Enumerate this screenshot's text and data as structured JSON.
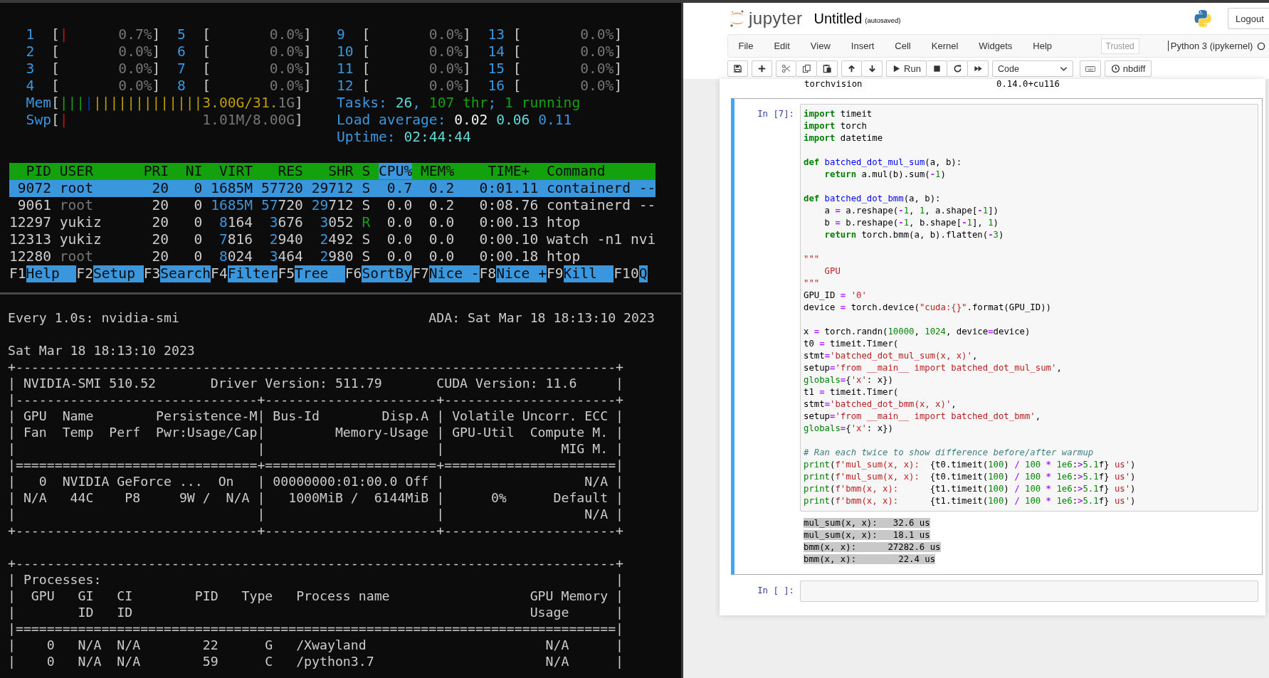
{
  "htop": {
    "meters": [
      {
        "runs": [
          {
            "text": "  1",
            "color": "#3a96dd"
          },
          "  [",
          {
            "text": "|",
            "color": "#c50f1f"
          },
          {
            "text": "      0.7%",
            "color": "#767676"
          },
          "]  ",
          {
            "text": "5",
            "color": "#3a96dd"
          },
          "  [",
          {
            "text": "       0.0%",
            "color": "#767676"
          },
          "]   ",
          {
            "text": "9",
            "color": "#3a96dd"
          },
          "  [",
          {
            "text": "       0.0%",
            "color": "#767676"
          },
          "]  ",
          {
            "text": "13",
            "color": "#3a96dd"
          },
          " [",
          {
            "text": "       0.0%",
            "color": "#767676"
          },
          "]"
        ]
      },
      {
        "runs": [
          {
            "text": "  2",
            "color": "#3a96dd"
          },
          "  [",
          {
            "text": "       0.0%",
            "color": "#767676"
          },
          "]  ",
          {
            "text": "6",
            "color": "#3a96dd"
          },
          "  [",
          {
            "text": "       0.0%",
            "color": "#767676"
          },
          "]   ",
          {
            "text": "10",
            "color": "#3a96dd"
          },
          " [",
          {
            "text": "       0.0%",
            "color": "#767676"
          },
          "]  ",
          {
            "text": "14",
            "color": "#3a96dd"
          },
          " [",
          {
            "text": "       0.0%",
            "color": "#767676"
          },
          "]"
        ]
      },
      {
        "runs": [
          {
            "text": "  3",
            "color": "#3a96dd"
          },
          "  [",
          {
            "text": "       0.0%",
            "color": "#767676"
          },
          "]  ",
          {
            "text": "7",
            "color": "#3a96dd"
          },
          "  [",
          {
            "text": "       0.0%",
            "color": "#767676"
          },
          "]   ",
          {
            "text": "11",
            "color": "#3a96dd"
          },
          " [",
          {
            "text": "       0.0%",
            "color": "#767676"
          },
          "]  ",
          {
            "text": "15",
            "color": "#3a96dd"
          },
          " [",
          {
            "text": "       0.0%",
            "color": "#767676"
          },
          "]"
        ]
      },
      {
        "runs": [
          {
            "text": "  4",
            "color": "#3a96dd"
          },
          "  [",
          {
            "text": "       0.0%",
            "color": "#767676"
          },
          "]  ",
          {
            "text": "8",
            "color": "#3a96dd"
          },
          "  [",
          {
            "text": "       0.0%",
            "color": "#767676"
          },
          "]   ",
          {
            "text": "12",
            "color": "#3a96dd"
          },
          " [",
          {
            "text": "       0.0%",
            "color": "#767676"
          },
          "]  ",
          {
            "text": "16",
            "color": "#3a96dd"
          },
          " [",
          {
            "text": "       0.0%",
            "color": "#767676"
          },
          "]"
        ]
      },
      {
        "runs": [
          {
            "text": "  Mem",
            "color": "#3a96dd"
          },
          "[",
          {
            "text": "|||",
            "color": "#13a10e"
          },
          {
            "text": "|",
            "color": "#0037da"
          },
          {
            "text": "|||||||||||||3.00G/31.",
            "color": "#c19c00"
          },
          {
            "text": "1G",
            "color": "#767676"
          },
          "]    ",
          {
            "text": "Tasks: ",
            "color": "#3a96dd"
          },
          {
            "text": "26",
            "color": "#61d6d6"
          },
          {
            "text": ", ",
            "color": "#3a96dd"
          },
          {
            "text": "107 thr",
            "color": "#13a10e"
          },
          {
            "text": "; ",
            "color": "#3a96dd"
          },
          {
            "text": "1 running",
            "color": "#13a10e"
          }
        ]
      },
      {
        "runs": [
          {
            "text": "  Swp",
            "color": "#3a96dd"
          },
          "[",
          {
            "text": "|",
            "color": "#c50f1f"
          },
          {
            "text": "                1.01M/8.00G",
            "color": "#767676"
          },
          "]    ",
          {
            "text": "Load average: ",
            "color": "#3a96dd"
          },
          {
            "text": "0.02 ",
            "color": "#f2f2f2"
          },
          {
            "text": "0.06 ",
            "color": "#61d6d6"
          },
          {
            "text": "0.11",
            "color": "#3a96dd"
          }
        ]
      },
      {
        "runs": [
          {
            "text": "                                       Uptime: ",
            "color": "#3a96dd"
          },
          {
            "text": "02:44:44",
            "color": "#61d6d6"
          }
        ]
      }
    ],
    "process_header": {
      "runs": [
        "  PID USER      PRI  NI  VIRT   RES   SHR S ",
        {
          "text": "CPU%",
          "selected": true
        },
        " MEM%    TIME+  Command"
      ]
    },
    "processes": [
      {
        "selected": true,
        "runs": [
          " 9072 root       20   0 1685M 57720 29712 S  0.7  0.2   0:01.11 containerd --"
        ]
      },
      {
        "selected": false,
        "runs": [
          " 9061 ",
          {
            "text": "root",
            "color": "#767676"
          },
          "       20   0 ",
          {
            "text": "1685M ",
            "color": "#3a96dd"
          },
          {
            "text": "57",
            "color": "#3a96dd"
          },
          "720 ",
          {
            "text": "29",
            "color": "#3a96dd"
          },
          "712 S  0.0  0.2   0:08.76 containerd --"
        ]
      },
      {
        "selected": false,
        "runs": [
          "12297 yukiz      20   0  ",
          {
            "text": "8",
            "color": "#3a96dd"
          },
          "164  ",
          {
            "text": "3",
            "color": "#3a96dd"
          },
          "676  ",
          {
            "text": "3",
            "color": "#3a96dd"
          },
          "052 ",
          {
            "text": "R",
            "color": "#13a10e"
          },
          "  0.0  0.0   0:00.13 htop"
        ]
      },
      {
        "selected": false,
        "runs": [
          "12313 yukiz      20   0  ",
          {
            "text": "7",
            "color": "#3a96dd"
          },
          "816  ",
          {
            "text": "2",
            "color": "#3a96dd"
          },
          "940  ",
          {
            "text": "2",
            "color": "#3a96dd"
          },
          "492 S  0.0  0.0   0:00.10 watch -n1 nvi"
        ]
      },
      {
        "selected": false,
        "runs": [
          "12280 ",
          {
            "text": "root",
            "color": "#767676"
          },
          "       20   0  ",
          {
            "text": "8",
            "color": "#3a96dd"
          },
          "024  ",
          {
            "text": "3",
            "color": "#3a96dd"
          },
          "464  ",
          {
            "text": "2",
            "color": "#3a96dd"
          },
          "980 S  0.0  0.0   0:00.18 htop"
        ]
      }
    ],
    "function_keys": [
      {
        "key": "F1",
        "label": "Help"
      },
      {
        "key": "F2",
        "label": "Setup"
      },
      {
        "key": "F3",
        "label": "Search"
      },
      {
        "key": "F4",
        "label": "Filter"
      },
      {
        "key": "F5",
        "label": "Tree"
      },
      {
        "key": "F6",
        "label": "SortBy"
      },
      {
        "key": "F7",
        "label": "Nice -"
      },
      {
        "key": "F8",
        "label": "Nice +"
      },
      {
        "key": "F9",
        "label": "Kill"
      },
      {
        "key": "F10",
        "label": "Q"
      }
    ]
  },
  "nvidia_smi": {
    "command": "Every 1.0s: nvidia-smi",
    "host_time": "ADA: Sat Mar 18 18:13:10 2023",
    "timestamp": "Sat Mar 18 18:13:10 2023",
    "gpu_table": [
      "+-----------------------------------------------------------------------------+",
      "| NVIDIA-SMI 510.52       Driver Version: 511.79       CUDA Version: 11.6     |",
      "|-------------------------------+----------------------+----------------------+",
      "| GPU  Name        Persistence-M| Bus-Id        Disp.A | Volatile Uncorr. ECC |",
      "| Fan  Temp  Perf  Pwr:Usage/Cap|         Memory-Usage | GPU-Util  Compute M. |",
      "|                               |                      |               MIG M. |",
      "|===============================+======================+======================|",
      "|   0  NVIDIA GeForce ...  On   | 00000000:01:00.0 Off |                  N/A |",
      "| N/A   44C    P8     9W /  N/A |   1000MiB /  6144MiB |      0%      Default |",
      "|                               |                      |                  N/A |",
      "+-------------------------------+----------------------+----------------------+"
    ],
    "process_table": [
      "+-----------------------------------------------------------------------------+",
      "| Processes:                                                                  |",
      "|  GPU   GI   CI        PID   Type   Process name                  GPU Memory |",
      "|        ID   ID                                                   Usage      |",
      "|=============================================================================|",
      "|    0   N/A  N/A        22      G   /Xwayland                       N/A      |",
      "|    0   N/A  N/A        59      C   /python3.7                      N/A      |"
    ]
  },
  "jupyter": {
    "logo_text": "jupyter",
    "title": "Untitled",
    "save_status": "(autosaved)",
    "logout": "Logout",
    "menu": [
      "File",
      "Edit",
      "View",
      "Insert",
      "Cell",
      "Kernel",
      "Widgets",
      "Help"
    ],
    "trusted": "Trusted",
    "kernel": "Python 3 (ipykernel)",
    "toolbar": {
      "run": "Run",
      "cell_type": "Code",
      "nbdiff": "nbdiff"
    },
    "previous_output": {
      "package": "torchvision",
      "version": "0.14.0+cu116"
    },
    "cells": [
      {
        "prompt": "In [7]:",
        "selected": true,
        "code_blocks": [
          {
            "lines": [
              {
                "runs": [
                  {
                    "text": "import",
                    "kind": "keyword"
                  },
                  " timeit"
                ]
              },
              {
                "runs": [
                  {
                    "text": "import",
                    "kind": "keyword"
                  },
                  " torch"
                ]
              },
              {
                "runs": [
                  {
                    "text": "import",
                    "kind": "keyword"
                  },
                  " datetime"
                ]
              }
            ]
          },
          {
            "lines": [
              {
                "runs": [
                  {
                    "text": "def",
                    "kind": "keyword"
                  },
                  {
                    "text": " batched_dot_mul_sum",
                    "kind": "function"
                  },
                  "(a, b):"
                ]
              },
              {
                "runs": [
                  {
                    "text": "    return",
                    "kind": "keyword"
                  },
                  " a.mul(b).sum(",
                  {
                    "text": "-",
                    "kind": "operator"
                  },
                  {
                    "text": "1",
                    "kind": "number"
                  },
                  ")"
                ]
              }
            ]
          },
          {
            "lines": [
              {
                "runs": [
                  {
                    "text": "def",
                    "kind": "keyword"
                  },
                  {
                    "text": " batched_dot_bmm",
                    "kind": "function"
                  },
                  "(a, b):"
                ]
              },
              {
                "runs": [
                  "    a ",
                  {
                    "text": "=",
                    "kind": "operator"
                  },
                  " a.reshape(",
                  {
                    "text": "-",
                    "kind": "operator"
                  },
                  {
                    "text": "1",
                    "kind": "number"
                  },
                  ", ",
                  {
                    "text": "1",
                    "kind": "number"
                  },
                  ", a.shape[",
                  {
                    "text": "-",
                    "kind": "operator"
                  },
                  {
                    "text": "1",
                    "kind": "number"
                  },
                  "])"
                ]
              },
              {
                "runs": [
                  "    b ",
                  {
                    "text": "=",
                    "kind": "operator"
                  },
                  " b.reshape(",
                  {
                    "text": "-",
                    "kind": "operator"
                  },
                  {
                    "text": "1",
                    "kind": "number"
                  },
                  ", b.shape[",
                  {
                    "text": "-",
                    "kind": "operator"
                  },
                  {
                    "text": "1",
                    "kind": "number"
                  },
                  "], ",
                  {
                    "text": "1",
                    "kind": "number"
                  },
                  ")"
                ]
              },
              {
                "runs": [
                  {
                    "text": "    return",
                    "kind": "keyword"
                  },
                  " torch.bmm(a, b).flatten(",
                  {
                    "text": "-",
                    "kind": "operator"
                  },
                  {
                    "text": "3",
                    "kind": "number"
                  },
                  ")"
                ]
              }
            ]
          },
          {
            "lines": [
              {
                "runs": [
                  {
                    "text": "\"\"\"",
                    "kind": "string"
                  }
                ]
              },
              {
                "runs": [
                  {
                    "text": "    GPU",
                    "kind": "string"
                  }
                ]
              },
              {
                "runs": [
                  {
                    "text": "\"\"\"",
                    "kind": "string"
                  }
                ]
              },
              {
                "runs": [
                  "GPU_ID ",
                  {
                    "text": "=",
                    "kind": "operator"
                  },
                  {
                    "text": " '0'",
                    "kind": "string"
                  }
                ]
              },
              {
                "runs": [
                  "device ",
                  {
                    "text": "=",
                    "kind": "operator"
                  },
                  " torch.device(",
                  {
                    "text": "\"cuda:{}\"",
                    "kind": "string"
                  },
                  ".format(GPU_ID))"
                ]
              }
            ]
          },
          {
            "lines": [
              {
                "runs": [
                  "x ",
                  {
                    "text": "=",
                    "kind": "operator"
                  },
                  " torch.randn(",
                  {
                    "text": "10000",
                    "kind": "number"
                  },
                  ", ",
                  {
                    "text": "1024",
                    "kind": "number"
                  },
                  ", device",
                  {
                    "text": "=",
                    "kind": "operator"
                  },
                  "device)"
                ]
              },
              {
                "runs": [
                  "t0 ",
                  {
                    "text": "=",
                    "kind": "operator"
                  },
                  " timeit.Timer("
                ]
              },
              {
                "runs": [
                  "stmt",
                  {
                    "text": "=",
                    "kind": "operator"
                  },
                  {
                    "text": "'batched_dot_mul_sum(x, x)'",
                    "kind": "string"
                  },
                  ","
                ]
              },
              {
                "runs": [
                  "setup",
                  {
                    "text": "=",
                    "kind": "operator"
                  },
                  {
                    "text": "'from __main__ import batched_dot_mul_sum'",
                    "kind": "string"
                  },
                  ","
                ]
              },
              {
                "runs": [
                  {
                    "text": "globals",
                    "kind": "builtin"
                  },
                  {
                    "text": "=",
                    "kind": "operator"
                  },
                  "{",
                  {
                    "text": "'x'",
                    "kind": "string"
                  },
                  ": x})"
                ]
              },
              {
                "runs": [
                  "t1 ",
                  {
                    "text": "=",
                    "kind": "operator"
                  },
                  " timeit.Timer("
                ]
              },
              {
                "runs": [
                  "stmt",
                  {
                    "text": "=",
                    "kind": "operator"
                  },
                  {
                    "text": "'batched_dot_bmm(x, x)'",
                    "kind": "string"
                  },
                  ","
                ]
              },
              {
                "runs": [
                  "setup",
                  {
                    "text": "=",
                    "kind": "operator"
                  },
                  {
                    "text": "'from __main__ import batched_dot_bmm'",
                    "kind": "string"
                  },
                  ","
                ]
              },
              {
                "runs": [
                  {
                    "text": "globals",
                    "kind": "builtin"
                  },
                  {
                    "text": "=",
                    "kind": "operator"
                  },
                  "{",
                  {
                    "text": "'x'",
                    "kind": "string"
                  },
                  ": x})"
                ]
              }
            ]
          },
          {
            "lines": [
              {
                "runs": [
                  {
                    "text": "# Ran each twice to show difference before/after warmup",
                    "kind": "comment"
                  }
                ]
              },
              {
                "runs": [
                  {
                    "text": "print",
                    "kind": "builtin"
                  },
                  "(",
                  {
                    "text": "f'mul_sum(x, x):  ",
                    "kind": "string"
                  },
                  "{t0.timeit(",
                  {
                    "text": "100",
                    "kind": "number"
                  },
                  ") ",
                  {
                    "text": "/",
                    "kind": "operator"
                  },
                  {
                    "text": " 100",
                    "kind": "number"
                  },
                  {
                    "text": " *",
                    "kind": "operator"
                  },
                  {
                    "text": " 1e6",
                    "kind": "number"
                  },
                  ":",
                  {
                    "text": ">",
                    "kind": "operator"
                  },
                  {
                    "text": "5.1",
                    "kind": "number"
                  },
                  "f}",
                  {
                    "text": " us'",
                    "kind": "string"
                  },
                  ")"
                ]
              },
              {
                "runs": [
                  {
                    "text": "print",
                    "kind": "builtin"
                  },
                  "(",
                  {
                    "text": "f'mul_sum(x, x):  ",
                    "kind": "string"
                  },
                  "{t0.timeit(",
                  {
                    "text": "100",
                    "kind": "number"
                  },
                  ") ",
                  {
                    "text": "/",
                    "kind": "operator"
                  },
                  {
                    "text": " 100",
                    "kind": "number"
                  },
                  {
                    "text": " *",
                    "kind": "operator"
                  },
                  {
                    "text": " 1e6",
                    "kind": "number"
                  },
                  ":",
                  {
                    "text": ">",
                    "kind": "operator"
                  },
                  {
                    "text": "5.1",
                    "kind": "number"
                  },
                  "f}",
                  {
                    "text": " us'",
                    "kind": "string"
                  },
                  ")"
                ]
              },
              {
                "runs": [
                  {
                    "text": "print",
                    "kind": "builtin"
                  },
                  "(",
                  {
                    "text": "f'bmm(x, x):      ",
                    "kind": "string"
                  },
                  "{t1.timeit(",
                  {
                    "text": "100",
                    "kind": "number"
                  },
                  ") ",
                  {
                    "text": "/",
                    "kind": "operator"
                  },
                  {
                    "text": " 100",
                    "kind": "number"
                  },
                  {
                    "text": " *",
                    "kind": "operator"
                  },
                  {
                    "text": " 1e6",
                    "kind": "number"
                  },
                  ":",
                  {
                    "text": ">",
                    "kind": "operator"
                  },
                  {
                    "text": "5.1",
                    "kind": "number"
                  },
                  "f}",
                  {
                    "text": " us'",
                    "kind": "string"
                  },
                  ")"
                ]
              },
              {
                "runs": [
                  {
                    "text": "print",
                    "kind": "builtin"
                  },
                  "(",
                  {
                    "text": "f'bmm(x, x):      ",
                    "kind": "string"
                  },
                  "{t1.timeit(",
                  {
                    "text": "100",
                    "kind": "number"
                  },
                  ") ",
                  {
                    "text": "/",
                    "kind": "operator"
                  },
                  {
                    "text": " 100",
                    "kind": "number"
                  },
                  {
                    "text": " *",
                    "kind": "operator"
                  },
                  {
                    "text": " 1e6",
                    "kind": "number"
                  },
                  ":",
                  {
                    "text": ">",
                    "kind": "operator"
                  },
                  {
                    "text": "5.1",
                    "kind": "number"
                  },
                  "f}",
                  {
                    "text": " us'",
                    "kind": "string"
                  },
                  ")"
                ]
              }
            ]
          }
        ],
        "output": {
          "selected": true,
          "lines": [
            "mul_sum(x, x):   32.6 us",
            "mul_sum(x, x):   18.1 us",
            "bmm(x, x):      27282.6 us",
            "bmm(x, x):        22.4 us"
          ]
        }
      },
      {
        "prompt": "In [ ]:",
        "selected": false
      }
    ]
  }
}
